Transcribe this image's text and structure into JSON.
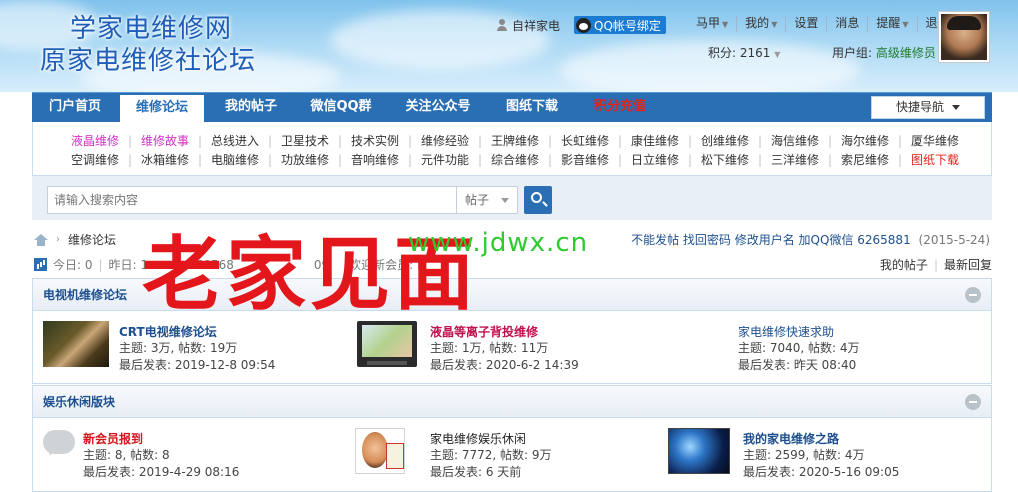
{
  "site": {
    "logo_line1": "学家电维修网",
    "logo_line2": "原家电维修社论坛"
  },
  "user_bar": {
    "user_name": "自祥家电",
    "qq_bind_label": "QQ帐号绑定",
    "links": [
      {
        "label": "马甲",
        "caret": true
      },
      {
        "label": "我的",
        "caret": true
      },
      {
        "label": "设置",
        "caret": false
      },
      {
        "label": "消息",
        "caret": false
      },
      {
        "label": "提醒",
        "caret": true
      },
      {
        "label": "退出",
        "caret": false
      }
    ],
    "points_label": "积分: 2161",
    "group_label": "用户组:",
    "group_value": "高级维修员"
  },
  "nav": {
    "items": [
      "门户首页",
      "维修论坛",
      "我的帖子",
      "微信QQ群",
      "关注公众号",
      "图纸下载",
      "积分充值"
    ],
    "active_index": 1,
    "quick_nav_label": "快捷导航"
  },
  "sub_nav": {
    "row1": [
      "液晶维修",
      "维修故事",
      "总线进入",
      "卫星技术",
      "技术实例",
      "维修经验",
      "王牌维修",
      "长虹维修",
      "康佳维修",
      "创维维修",
      "海信维修",
      "海尔维修",
      "厦华维修"
    ],
    "row2": [
      "空调维修",
      "冰箱维修",
      "电脑维修",
      "功放维修",
      "音响维修",
      "元件功能",
      "综合维修",
      "影音维修",
      "日立维修",
      "松下维修",
      "三洋维修",
      "索尼维修",
      "图纸下载"
    ],
    "row1_colors": [
      "#d42ec4",
      "#d42ec4"
    ],
    "accent_red": "#e2231a"
  },
  "search": {
    "placeholder": "请输入搜索内容",
    "type_label": "帖子"
  },
  "breadcrumb": {
    "current": "维修论坛"
  },
  "right_links": {
    "text": "不能发帖 找回密码 修改用户名 加QQ微信 6265881",
    "date": "(2015-5-24)"
  },
  "stats": {
    "today": "今日: 0",
    "yesterday": "昨日: 1",
    "posts": "760568",
    "members_partial": "09",
    "welcome": "欢迎新会员: H"
  },
  "stats_right": {
    "my_threads": "我的帖子",
    "latest_replies": "最新回复"
  },
  "sections": [
    {
      "title": "电视机维修论坛",
      "forums": [
        {
          "name": "CRT电视维修论坛",
          "name_color": "#1e4f8f",
          "topics": "主题: 3万, 帖数: 19万",
          "last": "最后发表: 2019-12-8 09:54",
          "thumb": "handshake-thumbnail"
        },
        {
          "name": "液晶等离子背投维修",
          "name_color": "#c0104e",
          "topics": "主题: 1万, 帖数: 11万",
          "last": "最后发表: 2020-6-2 14:39",
          "thumb": "lcd-tv-thumbnail"
        },
        {
          "name": "家电维修快速求助",
          "name_color": "#1e4f8f",
          "topics": "主题: 7040, 帖数: 4万",
          "last": "最后发表: 昨天 08:40",
          "thumb": ""
        }
      ]
    },
    {
      "title": "娱乐休闲版块",
      "forums": [
        {
          "name": "新会员报到",
          "name_color": "#d4161c",
          "topics": "主题: 8, 帖数: 8",
          "last": "最后发表: 2019-4-29 08:16",
          "thumb": "chat-bubble-icon"
        },
        {
          "name": "家电维修娱乐休闲",
          "name_color": "#222222",
          "topics": "主题: 7772, 帖数: 9万",
          "last": "最后发表: 6 天前",
          "thumb": "cartoon-thumbnail"
        },
        {
          "name": "我的家电维修之路",
          "name_color": "#1e4f8f",
          "topics": "主题: 2599, 帖数: 4万",
          "last": "最后发表: 2020-5-16 09:05",
          "thumb": "lightning-thumbnail"
        }
      ]
    }
  ],
  "watermark": {
    "big_text": "老家见面",
    "url_text": "www.jdwx.cn",
    "big_color": "#e3161c",
    "url_color": "#2ecb2e"
  }
}
